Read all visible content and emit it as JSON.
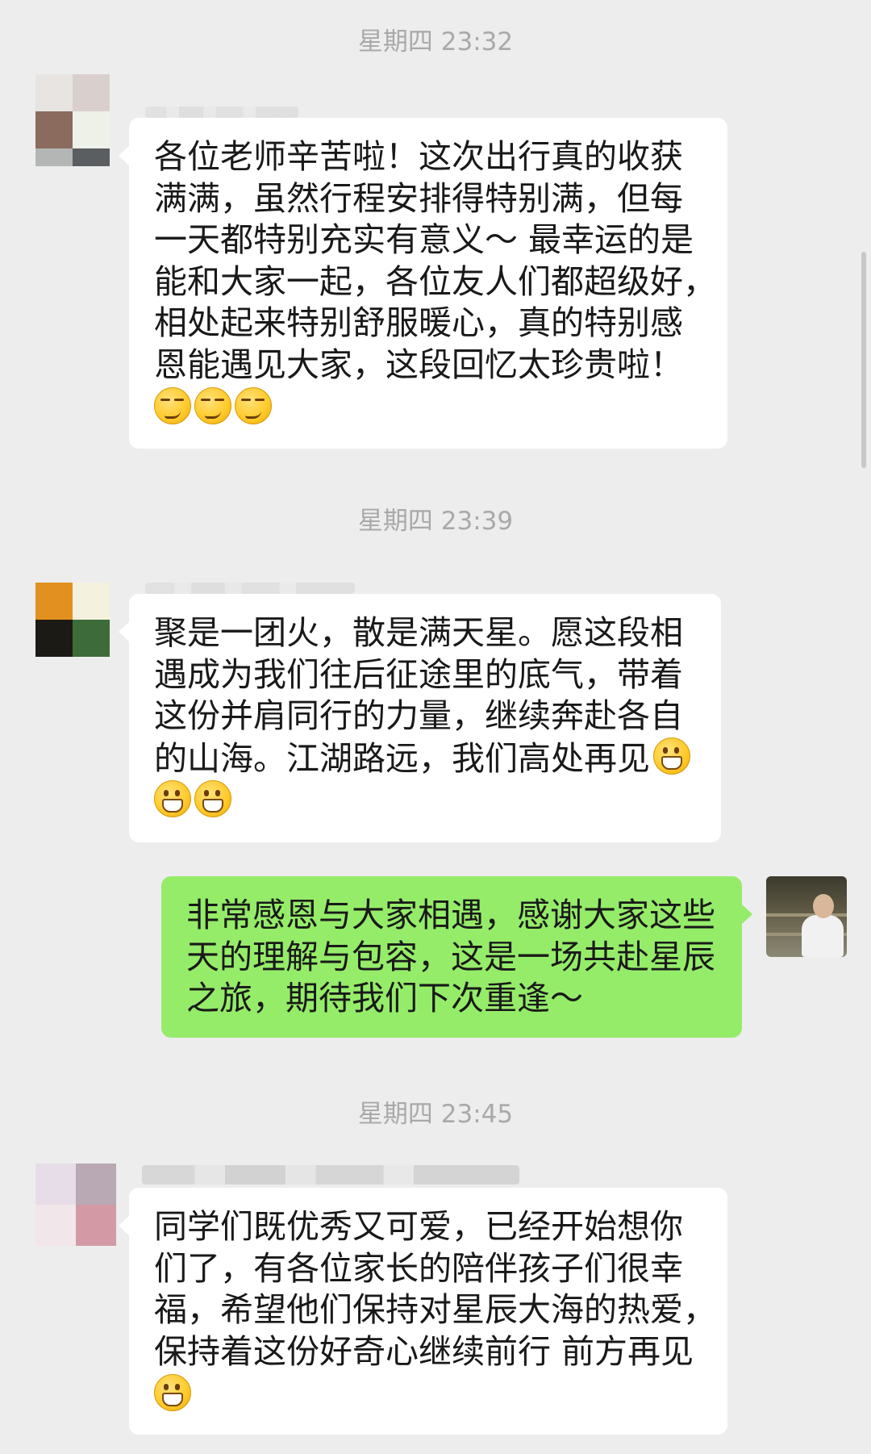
{
  "timestamps": [
    "星期四 23:32",
    "星期四 23:39",
    "星期四 23:45"
  ],
  "messages": [
    {
      "sender": "other",
      "lines": [
        "各位老师辛苦啦！这次出行真的收获",
        "满满，虽然行程安排得特别满，但每",
        "一天都特别充实有意义～ 最幸运的是",
        "能和大家一起，各位友人们都超级好，",
        "相处起来特别舒服暖心，真的特别感",
        "恩能遇见大家，这段回忆太珍贵啦！"
      ],
      "emoji": [
        "smirk-emoji",
        "smirk-emoji",
        "smirk-emoji"
      ]
    },
    {
      "sender": "other",
      "lines": [
        "聚是一团火，散是满天星。愿这段相",
        "遇成为我们往后征途里的底气，带着",
        "这份并肩同行的力量，继续奔赴各自",
        "的山海。江湖路远，我们高处再见"
      ],
      "emoji": [
        "grin-emoji",
        "grin-emoji",
        "grin-emoji"
      ]
    },
    {
      "sender": "self",
      "lines": [
        "非常感恩与大家相遇，感谢大家这些",
        "天的理解与包容，这是一场共赴星辰",
        "之旅，期待我们下次重逢～"
      ]
    },
    {
      "sender": "other",
      "lines": [
        "同学们既优秀又可爱，已经开始想你",
        "们了，有各位家长的陪伴孩子们很幸",
        "福，希望他们保持对星辰大海的热爱，",
        "保持着这份好奇心继续前行 前方再见"
      ],
      "emoji": [
        "grin-emoji"
      ]
    }
  ],
  "colors": {
    "background": "#ededed",
    "bubble_other": "#ffffff",
    "bubble_self": "#95ec69",
    "timestamp_text": "#a9a9a9",
    "message_text": "#191919"
  }
}
